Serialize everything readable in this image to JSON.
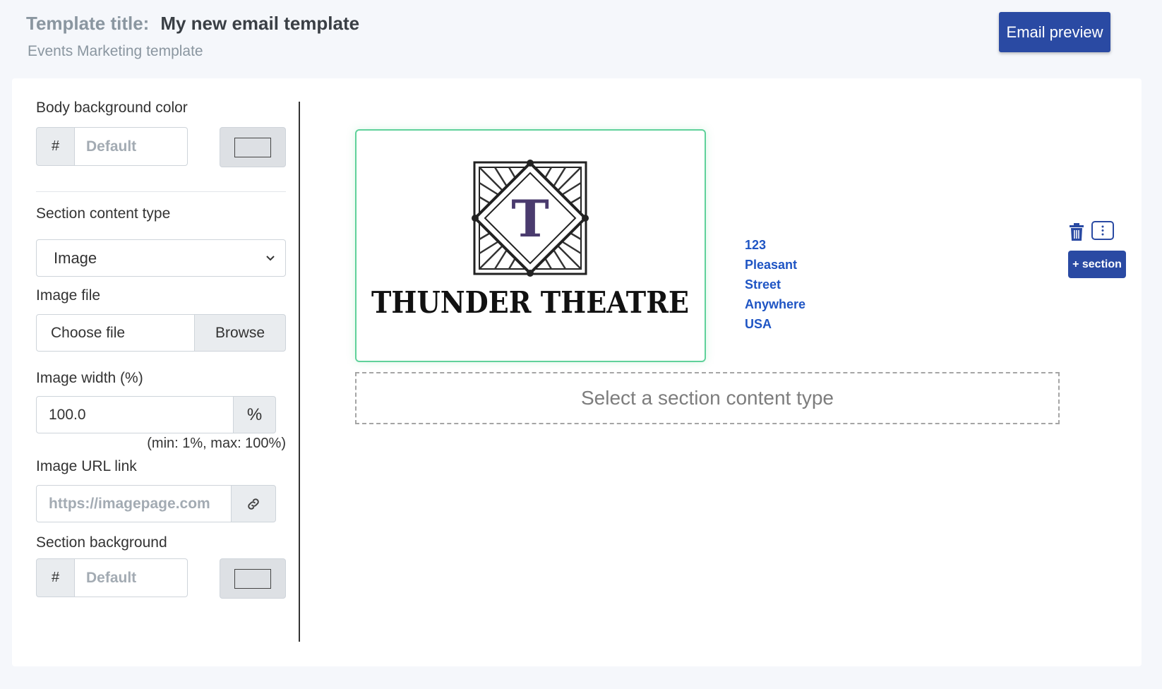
{
  "header": {
    "title_label": "Template title:",
    "title_value": "My new email template",
    "subtitle": "Events Marketing template",
    "preview_button": "Email preview"
  },
  "sidebar": {
    "body_bg": {
      "label": "Body background color",
      "prefix": "#",
      "placeholder": "Default"
    },
    "content_type": {
      "label": "Section content type",
      "value": "Image"
    },
    "image_file": {
      "label": "Image file",
      "placeholder": "Choose file",
      "browse": "Browse"
    },
    "image_width": {
      "label": "Image width (%)",
      "value": "100.0",
      "suffix": "%",
      "hint": "(min: 1%, max: 100%)"
    },
    "image_url": {
      "label": "Image URL link",
      "placeholder": "https://imagepage.com"
    },
    "section_bg": {
      "label": "Section background",
      "prefix": "#",
      "placeholder": "Default"
    }
  },
  "email": {
    "logo_text": "THUNDER THEATRE",
    "logo_letter": "T",
    "address_line1": "123 Pleasant Street",
    "address_line2": "Anywhere USA",
    "empty_section": "Select a section content type",
    "add_section": "+ section"
  },
  "icons": {
    "link": "link-icon",
    "trash": "trash-icon",
    "drag": "drag-handle-icon",
    "chevron": "chevron-down-icon"
  }
}
